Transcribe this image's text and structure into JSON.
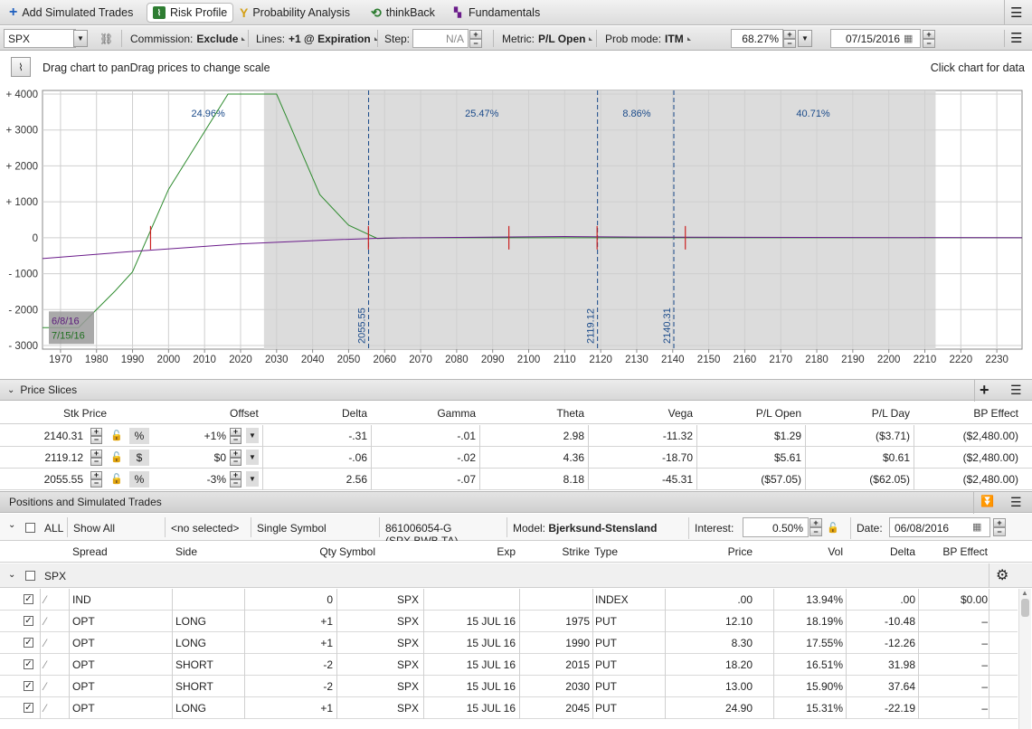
{
  "tabs": [
    {
      "label": "Add Simulated Trades",
      "icon": "plus-icon"
    },
    {
      "label": "Risk Profile",
      "icon": "risk-profile-icon",
      "active": true
    },
    {
      "label": "Probability Analysis",
      "icon": "probability-icon"
    },
    {
      "label": "thinkBack",
      "icon": "thinkback-icon"
    },
    {
      "label": "Fundamentals",
      "icon": "fundamentals-icon"
    }
  ],
  "toolbar": {
    "symbol": "SPX",
    "commission_label": "Commission:",
    "commission_value": "Exclude",
    "lines_label": "Lines:",
    "lines_value": "+1 @ Expiration",
    "step_label": "Step:",
    "step_value": "N/A",
    "metric_label": "Metric:",
    "metric_value": "P/L Open",
    "prob_label": "Prob mode:",
    "prob_value": "ITM",
    "percent_value": "68.27%",
    "date_value": "07/15/2016"
  },
  "hint": {
    "left": "Drag chart to panDrag prices to change scale",
    "right": "Click chart for data"
  },
  "chart_data": {
    "type": "line",
    "xlim": [
      1965,
      2237
    ],
    "ylim": [
      -3100,
      4100
    ],
    "xticks": [
      "1970",
      "1980",
      "1990",
      "2000",
      "2010",
      "2020",
      "2030",
      "2040",
      "2050",
      "2060",
      "2070",
      "2080",
      "2090",
      "2100",
      "2110",
      "2120",
      "2130",
      "2140",
      "2150",
      "2160",
      "2170",
      "2180",
      "2190",
      "2200",
      "2210",
      "2220",
      "2230"
    ],
    "yticks": [
      "+ 4000",
      "+ 3000",
      "+ 2000",
      "+ 1000",
      "0",
      "- 1000",
      "- 2000",
      "- 3000"
    ],
    "prob_regions": [
      {
        "from": 2026.5,
        "to": 2055.55,
        "label": "24.96%"
      },
      {
        "from": 2055.55,
        "to": 2119.12,
        "label": "25.47%"
      },
      {
        "from": 2119.12,
        "to": 2140.31,
        "label": "8.86%"
      },
      {
        "from": 2140.31,
        "to": 2213,
        "label": "40.71%"
      }
    ],
    "shaded_range": [
      2026.5,
      2213
    ],
    "label_positions_x": [
      2011,
      2087,
      2130,
      2179
    ],
    "price_lines": [
      {
        "x": 2055.55,
        "label": "2055.55"
      },
      {
        "x": 2119.12,
        "label": "2119.12"
      },
      {
        "x": 2140.31,
        "label": "2140.31"
      }
    ],
    "series": [
      {
        "name": "7/15/16",
        "color": "#2e8b2e",
        "points": [
          [
            1965,
            -2500
          ],
          [
            1975,
            -2500
          ],
          [
            1985,
            -1500
          ],
          [
            1990,
            -950
          ],
          [
            2000,
            1350
          ],
          [
            2016.5,
            4000
          ],
          [
            2030,
            4000
          ],
          [
            2042,
            1200
          ],
          [
            2050,
            350
          ],
          [
            2058,
            -20
          ],
          [
            2065,
            0
          ],
          [
            2237,
            0
          ]
        ]
      },
      {
        "name": "6/8/16",
        "color": "#6a1b8a",
        "points": [
          [
            1965,
            -580
          ],
          [
            1990,
            -380
          ],
          [
            2020,
            -170
          ],
          [
            2045,
            -60
          ],
          [
            2060,
            -10
          ],
          [
            2080,
            10
          ],
          [
            2110,
            35
          ],
          [
            2130,
            20
          ],
          [
            2237,
            0
          ]
        ]
      }
    ],
    "markers": [
      1995,
      2055.5,
      2094.5,
      2119,
      2143.5
    ],
    "legend": [
      "6/8/16",
      "7/15/16"
    ]
  },
  "price_slices": {
    "title": "Price Slices",
    "headers": [
      "Stk Price",
      "Offset",
      "Delta",
      "Gamma",
      "Theta",
      "Vega",
      "P/L Open",
      "P/L Day",
      "BP Effect"
    ],
    "rows": [
      {
        "price": "2140.31",
        "unit": "%",
        "offset": "+1%",
        "delta": "-.31",
        "gamma": "-.01",
        "theta": "2.98",
        "vega": "-11.32",
        "pl_open": "$1.29",
        "pl_day": "($3.71)",
        "bp": "($2,480.00)"
      },
      {
        "price": "2119.12",
        "unit": "$",
        "offset": "$0",
        "delta": "-.06",
        "gamma": "-.02",
        "theta": "4.36",
        "vega": "-18.70",
        "pl_open": "$5.61",
        "pl_day": "$0.61",
        "bp": "($2,480.00)"
      },
      {
        "price": "2055.55",
        "unit": "%",
        "offset": "-3%",
        "delta": "2.56",
        "gamma": "-.07",
        "theta": "8.18",
        "vega": "-45.31",
        "pl_open": "($57.05)",
        "pl_day": "($62.05)",
        "bp": "($2,480.00)"
      }
    ]
  },
  "positions": {
    "title": "Positions and Simulated Trades",
    "all_label": "ALL",
    "show_all": "Show All",
    "no_selected": "<no selected>",
    "single_symbol": "Single Symbol",
    "account": "861006054-G (SPX.BWB.TA)",
    "model_label": "Model:",
    "model_value": "Bjerksund-Stensland",
    "interest_label": "Interest:",
    "interest_value": "0.50%",
    "date_label": "Date:",
    "date_value": "06/08/2016",
    "headers": [
      "Spread",
      "Side",
      "Qty",
      "Symbol",
      "Exp",
      "Strike",
      "Type",
      "Price",
      "Vol",
      "Delta",
      "BP Effect"
    ],
    "group": "SPX",
    "rows": [
      {
        "spread": "IND",
        "side": "",
        "qty": "0",
        "symbol": "SPX",
        "exp": "",
        "strike": "",
        "type": "INDEX",
        "price": ".00",
        "vol": "13.94%",
        "delta": ".00",
        "bp": "$0.00"
      },
      {
        "spread": "OPT",
        "side": "LONG",
        "qty": "+1",
        "symbol": "SPX",
        "exp": "15 JUL 16",
        "strike": "1975",
        "type": "PUT",
        "price": "12.10",
        "vol": "18.19%",
        "delta": "-10.48",
        "bp": "–"
      },
      {
        "spread": "OPT",
        "side": "LONG",
        "qty": "+1",
        "symbol": "SPX",
        "exp": "15 JUL 16",
        "strike": "1990",
        "type": "PUT",
        "price": "8.30",
        "vol": "17.55%",
        "delta": "-12.26",
        "bp": "–"
      },
      {
        "spread": "OPT",
        "side": "SHORT",
        "qty": "-2",
        "symbol": "SPX",
        "exp": "15 JUL 16",
        "strike": "2015",
        "type": "PUT",
        "price": "18.20",
        "vol": "16.51%",
        "delta": "31.98",
        "bp": "–"
      },
      {
        "spread": "OPT",
        "side": "SHORT",
        "qty": "-2",
        "symbol": "SPX",
        "exp": "15 JUL 16",
        "strike": "2030",
        "type": "PUT",
        "price": "13.00",
        "vol": "15.90%",
        "delta": "37.64",
        "bp": "–"
      },
      {
        "spread": "OPT",
        "side": "LONG",
        "qty": "+1",
        "symbol": "SPX",
        "exp": "15 JUL 16",
        "strike": "2045",
        "type": "PUT",
        "price": "24.90",
        "vol": "15.31%",
        "delta": "-22.19",
        "bp": "–"
      }
    ]
  }
}
